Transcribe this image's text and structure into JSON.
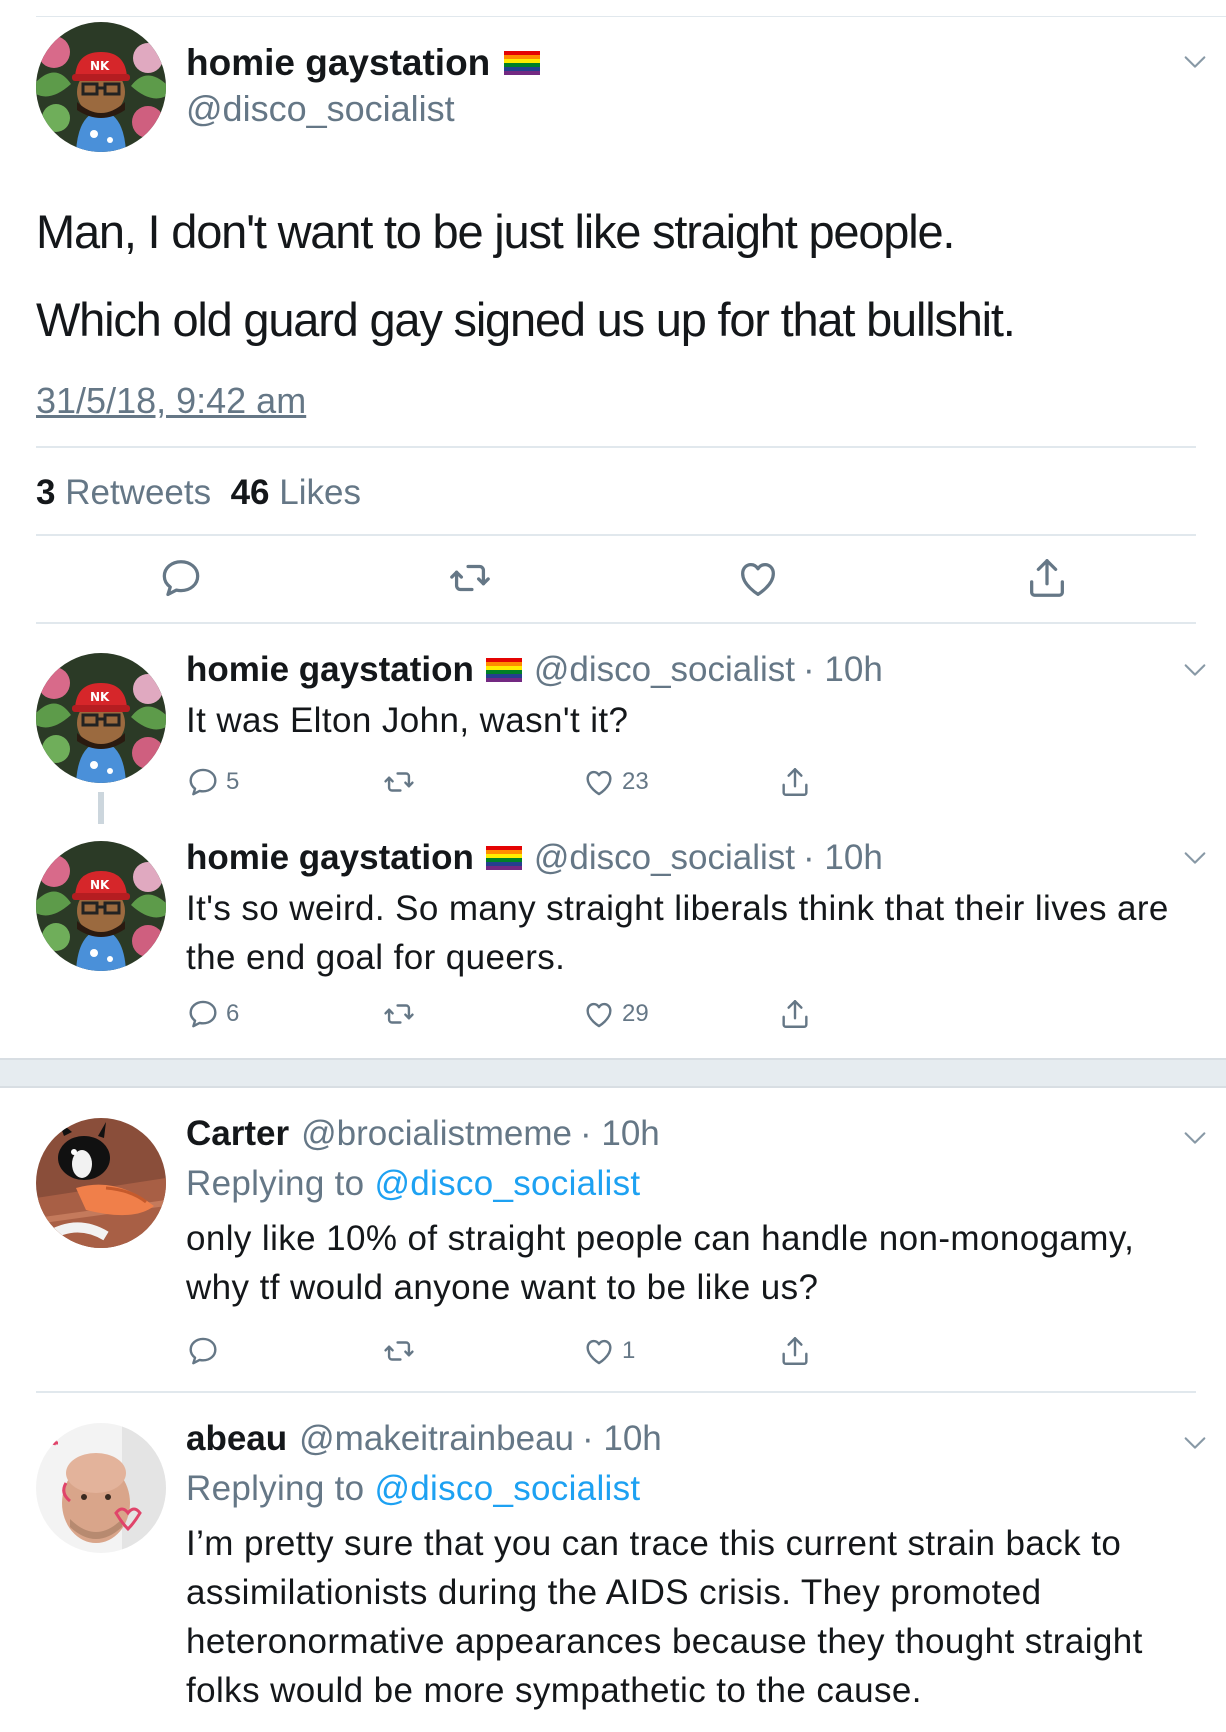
{
  "main_tweet": {
    "display_name": "homie gaystation",
    "handle": "@disco_socialist",
    "text_line1": "Man, I don't want to be just like straight people.",
    "text_line2": "Which old guard gay signed us up for that bullshit.",
    "timestamp": "31/5/18, 9:42 am",
    "retweet_count": "3",
    "retweet_label": "Retweets",
    "like_count": "46",
    "like_label": "Likes"
  },
  "replies": [
    {
      "display_name": "homie gaystation",
      "handle": "@disco_socialist",
      "time": "· 10h",
      "text": "It was Elton John, wasn't it?",
      "reply_count": "5",
      "retweet_count": "",
      "like_count": "23"
    },
    {
      "display_name": "homie gaystation",
      "handle": "@disco_socialist",
      "time": "· 10h",
      "text": "It's so weird. So many straight liberals think that their lives are the end goal for queers.",
      "reply_count": "6",
      "retweet_count": "",
      "like_count": "29"
    },
    {
      "display_name": "Carter",
      "handle": "@brocialistmeme",
      "time": "· 10h",
      "replying_prefix": "Replying to",
      "replying_to": "@disco_socialist",
      "text": "only like 10% of straight people can handle non-monogamy, why tf would anyone want to be like us?",
      "reply_count": "",
      "retweet_count": "",
      "like_count": "1"
    },
    {
      "display_name": "abeau",
      "handle": "@makeitrainbeau",
      "time": "· 10h",
      "replying_prefix": "Replying to",
      "replying_to": "@disco_socialist",
      "text": "I’m pretty sure that you can trace this current strain back to assimilationists during the AIDS crisis. They promoted heteronormative appearances because they thought straight folks would be more sympathetic to the cause."
    }
  ],
  "icons": {
    "reply": "reply-bubble-icon",
    "retweet": "retweet-icon",
    "like": "heart-icon",
    "share": "share-icon",
    "menu": "chevron-down-icon",
    "flag": "rainbow-flag-icon"
  },
  "colors": {
    "link": "#1da1f2",
    "secondary_text": "#657786",
    "divider": "#e1e8ed",
    "section_gap": "#e6ecf0"
  }
}
